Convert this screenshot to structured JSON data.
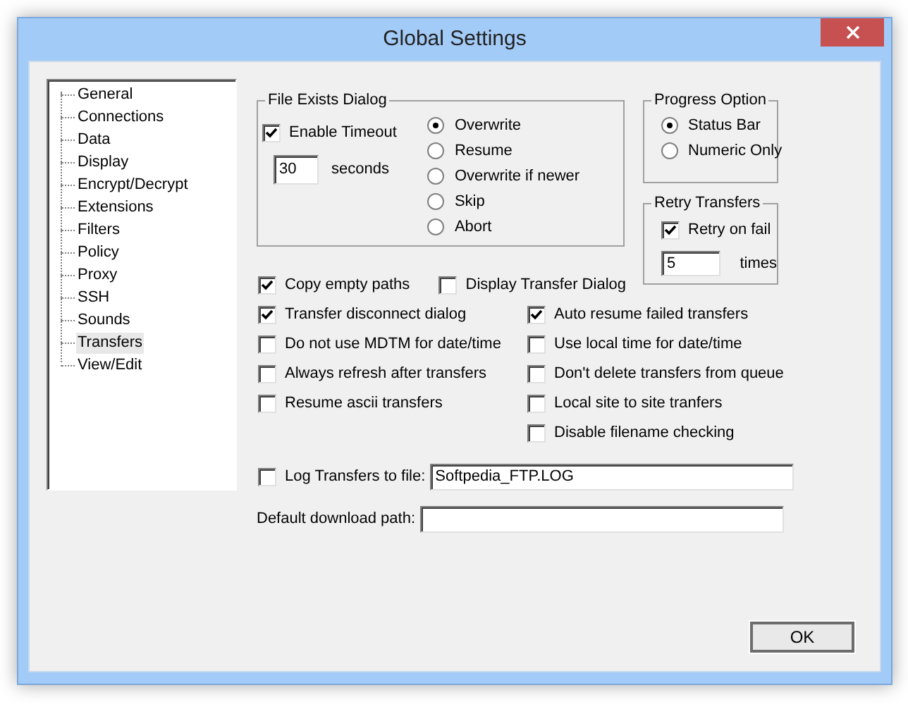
{
  "window": {
    "title": "Global Settings"
  },
  "tree": {
    "items": [
      {
        "label": "General",
        "selected": false
      },
      {
        "label": "Connections",
        "selected": false
      },
      {
        "label": "Data",
        "selected": false
      },
      {
        "label": "Display",
        "selected": false
      },
      {
        "label": "Encrypt/Decrypt",
        "selected": false
      },
      {
        "label": "Extensions",
        "selected": false
      },
      {
        "label": "Filters",
        "selected": false
      },
      {
        "label": "Policy",
        "selected": false
      },
      {
        "label": "Proxy",
        "selected": false
      },
      {
        "label": "SSH",
        "selected": false
      },
      {
        "label": "Sounds",
        "selected": false
      },
      {
        "label": "Transfers",
        "selected": true
      },
      {
        "label": "View/Edit",
        "selected": false
      }
    ]
  },
  "file_exists": {
    "title": "File Exists Dialog",
    "enable_timeout": {
      "label": "Enable Timeout",
      "checked": true
    },
    "timeout": {
      "value": "30",
      "unit": "seconds"
    },
    "options": [
      {
        "label": "Overwrite",
        "selected": true
      },
      {
        "label": "Resume",
        "selected": false
      },
      {
        "label": "Overwrite if newer",
        "selected": false
      },
      {
        "label": "Skip",
        "selected": false
      },
      {
        "label": "Abort",
        "selected": false
      }
    ]
  },
  "progress": {
    "title": "Progress Option",
    "options": [
      {
        "label": "Status Bar",
        "selected": true
      },
      {
        "label": "Numeric Only",
        "selected": false
      }
    ]
  },
  "retry": {
    "title": "Retry Transfers",
    "retry_on_fail": {
      "label": "Retry on fail",
      "checked": true
    },
    "count": {
      "value": "5",
      "unit": "times"
    }
  },
  "top_row": [
    {
      "label": "Copy empty paths",
      "checked": true
    },
    {
      "label": "Display Transfer Dialog",
      "checked": false
    }
  ],
  "left_options": [
    {
      "label": "Transfer disconnect dialog",
      "checked": true
    },
    {
      "label": "Do not use MDTM for date/time",
      "checked": false
    },
    {
      "label": "Always refresh after transfers",
      "checked": false
    },
    {
      "label": "Resume ascii transfers",
      "checked": false
    }
  ],
  "right_options": [
    {
      "label": "Auto resume failed transfers",
      "checked": true
    },
    {
      "label": "Use local time for date/time",
      "checked": false
    },
    {
      "label": "Don't delete transfers from queue",
      "checked": false
    },
    {
      "label": "Local site to site tranfers",
      "checked": false
    },
    {
      "label": "Disable filename checking",
      "checked": false
    }
  ],
  "log": {
    "label": "Log Transfers to file:",
    "checked": false,
    "value": "Softpedia_FTP.LOG"
  },
  "download_path": {
    "label": "Default download path:"
  },
  "buttons": [
    {
      "label": "OK"
    }
  ]
}
